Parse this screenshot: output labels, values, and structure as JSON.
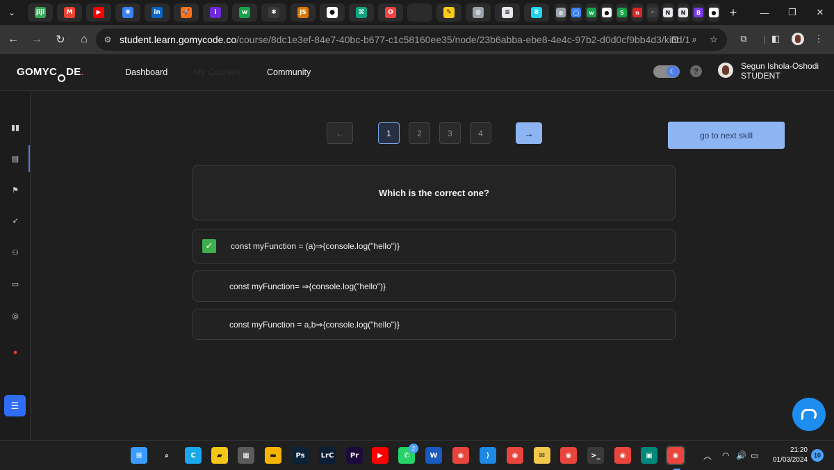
{
  "browser": {
    "tabs": [
      {
        "icon": "jiji-icon",
        "label": "jiji",
        "color": "#34a853"
      },
      {
        "icon": "gmail-icon",
        "label": "M",
        "color": "#ea4335"
      },
      {
        "icon": "youtube-icon",
        "label": "▶",
        "color": "#ff0000"
      },
      {
        "icon": "pinwheel-icon",
        "label": "✺",
        "color": "#3b82f6"
      },
      {
        "icon": "linkedin-icon",
        "label": "in",
        "color": "#0a66c2"
      },
      {
        "icon": "rocket-icon",
        "label": "🚀",
        "color": "#f97316"
      },
      {
        "icon": "info-circle-icon",
        "label": "i",
        "color": "#6d28d9"
      },
      {
        "icon": "w-logo-icon",
        "label": "w",
        "color": "#16a34a"
      },
      {
        "icon": "bug-icon",
        "label": "✱",
        "color": "#3a3a3a"
      },
      {
        "icon": "js-icon",
        "label": "JS",
        "color": "#d97706"
      },
      {
        "icon": "github-icon",
        "label": "●",
        "color": "#ffffff"
      },
      {
        "icon": "chatgpt-icon",
        "label": "⌘",
        "color": "#10a37f"
      },
      {
        "icon": "opera-icon",
        "label": "O",
        "color": "#ef4444"
      },
      {
        "icon": "blank-tab-icon",
        "label": "",
        "color": "#2b2b2b"
      },
      {
        "icon": "sticky-note-icon",
        "label": "✎",
        "color": "#facc15"
      },
      {
        "icon": "globe-icon",
        "label": "◍",
        "color": "#9ca3af"
      },
      {
        "icon": "document-icon",
        "label": "≡",
        "color": "#e5e7eb"
      },
      {
        "icon": "b-logo-icon",
        "label": "8",
        "color": "#22d3ee"
      }
    ],
    "mini_tabs": [
      {
        "icon": "globe-icon",
        "label": "◍",
        "color": "#9ca3af"
      },
      {
        "icon": "circle-o-icon",
        "label": "◯",
        "color": "#3b82f6"
      },
      {
        "icon": "w-logo-icon",
        "label": "w",
        "color": "#16a34a"
      },
      {
        "icon": "github-icon",
        "label": "●",
        "color": "#ffffff"
      },
      {
        "icon": "s-logo-icon",
        "label": "S",
        "color": "#16a34a"
      },
      {
        "icon": "n-logo-icon",
        "label": "n",
        "color": "#dc2626"
      },
      {
        "icon": "loading-icon",
        "label": "◜",
        "color": "#3a3a3a"
      },
      {
        "icon": "notion-icon",
        "label": "N",
        "color": "#e5e7eb"
      },
      {
        "icon": "notion-icon",
        "label": "N",
        "color": "#e5e7eb"
      },
      {
        "icon": "b-logo-icon",
        "label": "B",
        "color": "#7c3aed"
      },
      {
        "icon": "github-icon",
        "label": "●",
        "color": "#ffffff"
      }
    ],
    "new_tab": "+",
    "url_host": "student.learn.gomycode.co",
    "url_path": "/course/8dc1e3ef-84e7-40bc-b677-c1c58160ee35/node/23b6abba-ebe8-4e4c-97b2-d0d0cf9bb4d3/kind/1"
  },
  "header": {
    "logo_left": "GOMYC",
    "logo_o": "O",
    "logo_right": "DE",
    "logo_dot": ".",
    "nav": {
      "dashboard": "Dashboard",
      "my_courses": "My Courses",
      "community": "Community"
    },
    "help": "?",
    "user": {
      "name": "Segun Ishola-Oshodi",
      "role": "STUDENT"
    }
  },
  "quiz": {
    "pages": [
      "1",
      "2",
      "3",
      "4"
    ],
    "current_page": "1",
    "next_skill": "go to next skill",
    "question": "Which is the correct one?",
    "options": [
      {
        "text": "const myFunction = (a)⇒{console.log(\"hello\")}",
        "selected": true
      },
      {
        "text": "const myFunction= ⇒{console.log(\"hello\")}",
        "selected": false
      },
      {
        "text": "const myFunction = a,b⇒{console.log(\"hello\")}",
        "selected": false
      }
    ]
  },
  "taskbar": {
    "whatsapp_badge": "2",
    "time": "21:20",
    "date": "01/03/2024",
    "notifications": "10",
    "apps": [
      {
        "icon": "windows-start-icon",
        "color": "#3b9cff",
        "label": "⊞"
      },
      {
        "icon": "search-icon",
        "color": "#202020",
        "label": "⌕"
      },
      {
        "icon": "copilot-icon",
        "color": "#1aa7ec",
        "label": "C"
      },
      {
        "icon": "sticky-notes-icon",
        "color": "#f5c518",
        "label": "▰"
      },
      {
        "icon": "calculator-icon",
        "color": "#5b5b5b",
        "label": "▦"
      },
      {
        "icon": "file-explorer-icon",
        "color": "#f4b400",
        "label": "▬"
      },
      {
        "icon": "photoshop-icon",
        "color": "#0c2238",
        "label": "Ps"
      },
      {
        "icon": "lightroom-classic-icon",
        "color": "#0b1e33",
        "label": "LrC"
      },
      {
        "icon": "premiere-icon",
        "color": "#1d0a3a",
        "label": "Pr"
      },
      {
        "icon": "youtube-icon",
        "color": "#ff0000",
        "label": "▶"
      },
      {
        "icon": "whatsapp-icon",
        "color": "#25d366",
        "label": "✆"
      },
      {
        "icon": "word-icon",
        "color": "#185abd",
        "label": "W"
      },
      {
        "icon": "chrome-icon",
        "color": "#e8453c",
        "label": "◉"
      },
      {
        "icon": "vscode-icon",
        "color": "#1e88e5",
        "label": "⟩"
      },
      {
        "icon": "chrome-profile-icon",
        "color": "#e8453c",
        "label": "◉"
      },
      {
        "icon": "mail-icon",
        "color": "#f2c94c",
        "label": "✉"
      },
      {
        "icon": "chrome-profile-icon",
        "color": "#e8453c",
        "label": "◉"
      },
      {
        "icon": "terminal-icon",
        "color": "#3a3a3a",
        "label": ">_"
      },
      {
        "icon": "chrome-profile-icon",
        "color": "#e8453c",
        "label": "◉"
      },
      {
        "icon": "meet-icon",
        "color": "#00897b",
        "label": "▣"
      },
      {
        "icon": "chrome-active-icon",
        "color": "#e8453c",
        "label": "◉"
      }
    ]
  }
}
